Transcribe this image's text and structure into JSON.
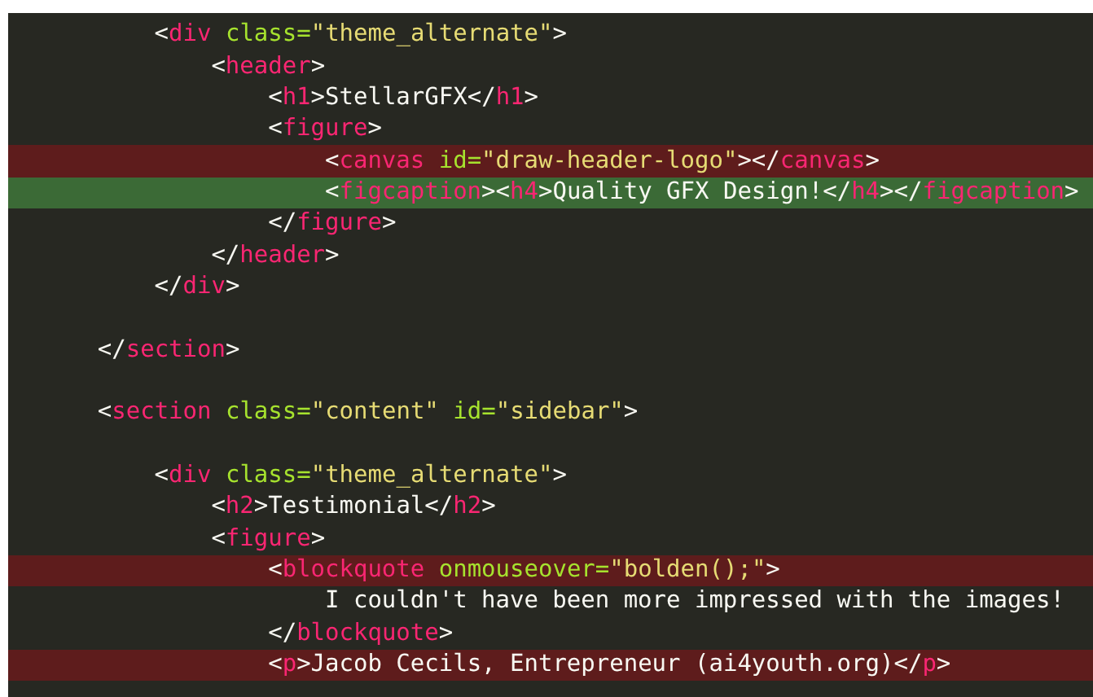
{
  "editor": {
    "lines": [
      {
        "kind": "context",
        "children": [
          {
            "kind": "code",
            "highlighted": false,
            "tokens": [
              {
                "kind": "punct",
                "text": "<"
              },
              {
                "kind": "tag",
                "text": "div"
              },
              {
                "kind": "attr",
                "text": " class="
              },
              {
                "kind": "string",
                "text": "\"theme_alternate\""
              },
              {
                "kind": "punct",
                "text": ">"
              }
            ],
            "children": [
              {
                "kind": "code",
                "highlighted": false,
                "tokens": [
                  {
                    "kind": "punct",
                    "text": "<"
                  },
                  {
                    "kind": "tag",
                    "text": "header"
                  },
                  {
                    "kind": "punct",
                    "text": ">"
                  }
                ],
                "children": [
                  {
                    "kind": "code",
                    "highlighted": false,
                    "tokens": [
                      {
                        "kind": "punct",
                        "text": "<"
                      },
                      {
                        "kind": "tag",
                        "text": "h1"
                      },
                      {
                        "kind": "punct",
                        "text": ">"
                      },
                      {
                        "kind": "text",
                        "text": "StellarGFX"
                      },
                      {
                        "kind": "punct",
                        "text": "</"
                      },
                      {
                        "kind": "tag",
                        "text": "h1"
                      },
                      {
                        "kind": "punct",
                        "text": ">"
                      }
                    ]
                  },
                  {
                    "kind": "code",
                    "highlighted": false,
                    "tokens": [
                      {
                        "kind": "punct",
                        "text": "<"
                      },
                      {
                        "kind": "tag",
                        "text": "figure"
                      },
                      {
                        "kind": "punct",
                        "text": ">"
                      }
                    ],
                    "children": [
                      {
                        "kind": "code",
                        "highlighted": true,
                        "color": "#5e1c1c",
                        "tokens": [
                          {
                            "kind": "punct",
                            "text": "<"
                          },
                          {
                            "kind": "tag",
                            "text": "canvas"
                          },
                          {
                            "kind": "attr",
                            "text": " id="
                          },
                          {
                            "kind": "string",
                            "text": "\"draw-header-logo\""
                          },
                          {
                            "kind": "punct",
                            "text": "></"
                          },
                          {
                            "kind": "tag",
                            "text": "canvas"
                          },
                          {
                            "kind": "punct",
                            "text": ">"
                          }
                        ]
                      },
                      {
                        "kind": "code",
                        "highlighted": true,
                        "color": "#3b6a36",
                        "tokens": [
                          {
                            "kind": "punct",
                            "text": "<"
                          },
                          {
                            "kind": "tag",
                            "text": "figcaption"
                          },
                          {
                            "kind": "punct",
                            "text": "><"
                          },
                          {
                            "kind": "tag",
                            "text": "h4"
                          },
                          {
                            "kind": "punct",
                            "text": ">"
                          },
                          {
                            "kind": "text",
                            "text": "Quality GFX Design!"
                          },
                          {
                            "kind": "punct",
                            "text": "</"
                          },
                          {
                            "kind": "tag",
                            "text": "h4"
                          },
                          {
                            "kind": "punct",
                            "text": "></"
                          },
                          {
                            "kind": "tag",
                            "text": "figcaption"
                          },
                          {
                            "kind": "punct",
                            "text": ">"
                          }
                        ]
                      }
                    ]
                  },
                  {
                    "kind": "code",
                    "highlighted": false,
                    "tokens": [
                      {
                        "kind": "punct",
                        "text": "</"
                      },
                      {
                        "kind": "tag",
                        "text": "figure"
                      },
                      {
                        "kind": "punct",
                        "text": ">"
                      }
                    ]
                  }
                ]
              },
              {
                "kind": "code",
                "highlighted": false,
                "tokens": [
                  {
                    "kind": "punct",
                    "text": "</"
                  },
                  {
                    "kind": "tag",
                    "text": "header"
                  },
                  {
                    "kind": "punct",
                    "text": ">"
                  }
                ]
              }
            ]
          },
          {
            "kind": "code",
            "highlighted": false,
            "tokens": [
              {
                "kind": "punct",
                "text": "</"
              },
              {
                "kind": "tag",
                "text": "div"
              },
              {
                "kind": "punct",
                "text": ">"
              }
            ]
          }
        ]
      },
      {
        "kind": "blank"
      },
      {
        "kind": "code",
        "highlighted": false,
        "tokens": [
          {
            "kind": "punct",
            "text": "</"
          },
          {
            "kind": "tag",
            "text": "section"
          },
          {
            "kind": "punct",
            "text": ">"
          }
        ]
      },
      {
        "kind": "blank"
      },
      {
        "kind": "code",
        "highlighted": false,
        "tokens": [
          {
            "kind": "punct",
            "text": "<"
          },
          {
            "kind": "tag",
            "text": "section"
          },
          {
            "kind": "attr",
            "text": " class="
          },
          {
            "kind": "string",
            "text": "\"content\""
          },
          {
            "kind": "attr",
            "text": " id="
          },
          {
            "kind": "string",
            "text": "\"sidebar\""
          },
          {
            "kind": "punct",
            "text": ">"
          }
        ],
        "children": [
          {
            "kind": "blank"
          },
          {
            "kind": "code",
            "highlighted": false,
            "tokens": [
              {
                "kind": "punct",
                "text": "<"
              },
              {
                "kind": "tag",
                "text": "div"
              },
              {
                "kind": "attr",
                "text": " class="
              },
              {
                "kind": "string",
                "text": "\"theme_alternate\""
              },
              {
                "kind": "punct",
                "text": ">"
              }
            ],
            "children": [
              {
                "kind": "code",
                "highlighted": false,
                "tokens": [
                  {
                    "kind": "punct",
                    "text": "<"
                  },
                  {
                    "kind": "tag",
                    "text": "h2"
                  },
                  {
                    "kind": "punct",
                    "text": ">"
                  },
                  {
                    "kind": "text",
                    "text": "Testimonial"
                  },
                  {
                    "kind": "punct",
                    "text": "</"
                  },
                  {
                    "kind": "tag",
                    "text": "h2"
                  },
                  {
                    "kind": "punct",
                    "text": ">"
                  }
                ]
              },
              {
                "kind": "code",
                "highlighted": false,
                "tokens": [
                  {
                    "kind": "punct",
                    "text": "<"
                  },
                  {
                    "kind": "tag",
                    "text": "figure"
                  },
                  {
                    "kind": "punct",
                    "text": ">"
                  }
                ],
                "children": [
                  {
                    "kind": "code",
                    "highlighted": true,
                    "color": "#5e1c1c",
                    "tokens": [
                      {
                        "kind": "punct",
                        "text": "<"
                      },
                      {
                        "kind": "tag",
                        "text": "blockquote"
                      },
                      {
                        "kind": "attr",
                        "text": " onmouseover="
                      },
                      {
                        "kind": "string",
                        "text": "\"bolden();\""
                      },
                      {
                        "kind": "punct",
                        "text": ">"
                      }
                    ],
                    "children": [
                      {
                        "kind": "code",
                        "highlighted": false,
                        "tokens": [
                          {
                            "kind": "text",
                            "text": "I couldn't have been more impressed with the images!"
                          }
                        ]
                      }
                    ]
                  },
                  {
                    "kind": "code",
                    "highlighted": false,
                    "tokens": [
                      {
                        "kind": "punct",
                        "text": "</"
                      },
                      {
                        "kind": "tag",
                        "text": "blockquote"
                      },
                      {
                        "kind": "punct",
                        "text": ">"
                      }
                    ]
                  },
                  {
                    "kind": "code",
                    "highlighted": true,
                    "color": "#5e1c1c",
                    "tokens": [
                      {
                        "kind": "punct",
                        "text": "<"
                      },
                      {
                        "kind": "tag",
                        "text": "p"
                      },
                      {
                        "kind": "punct",
                        "text": ">"
                      },
                      {
                        "kind": "text",
                        "text": "Jacob Cecils, Entrepreneur (ai4youth.org)"
                      },
                      {
                        "kind": "punct",
                        "text": "</"
                      },
                      {
                        "kind": "tag",
                        "text": "p"
                      },
                      {
                        "kind": "punct",
                        "text": ">"
                      }
                    ]
                  }
                ]
              }
            ]
          }
        ]
      }
    ]
  }
}
